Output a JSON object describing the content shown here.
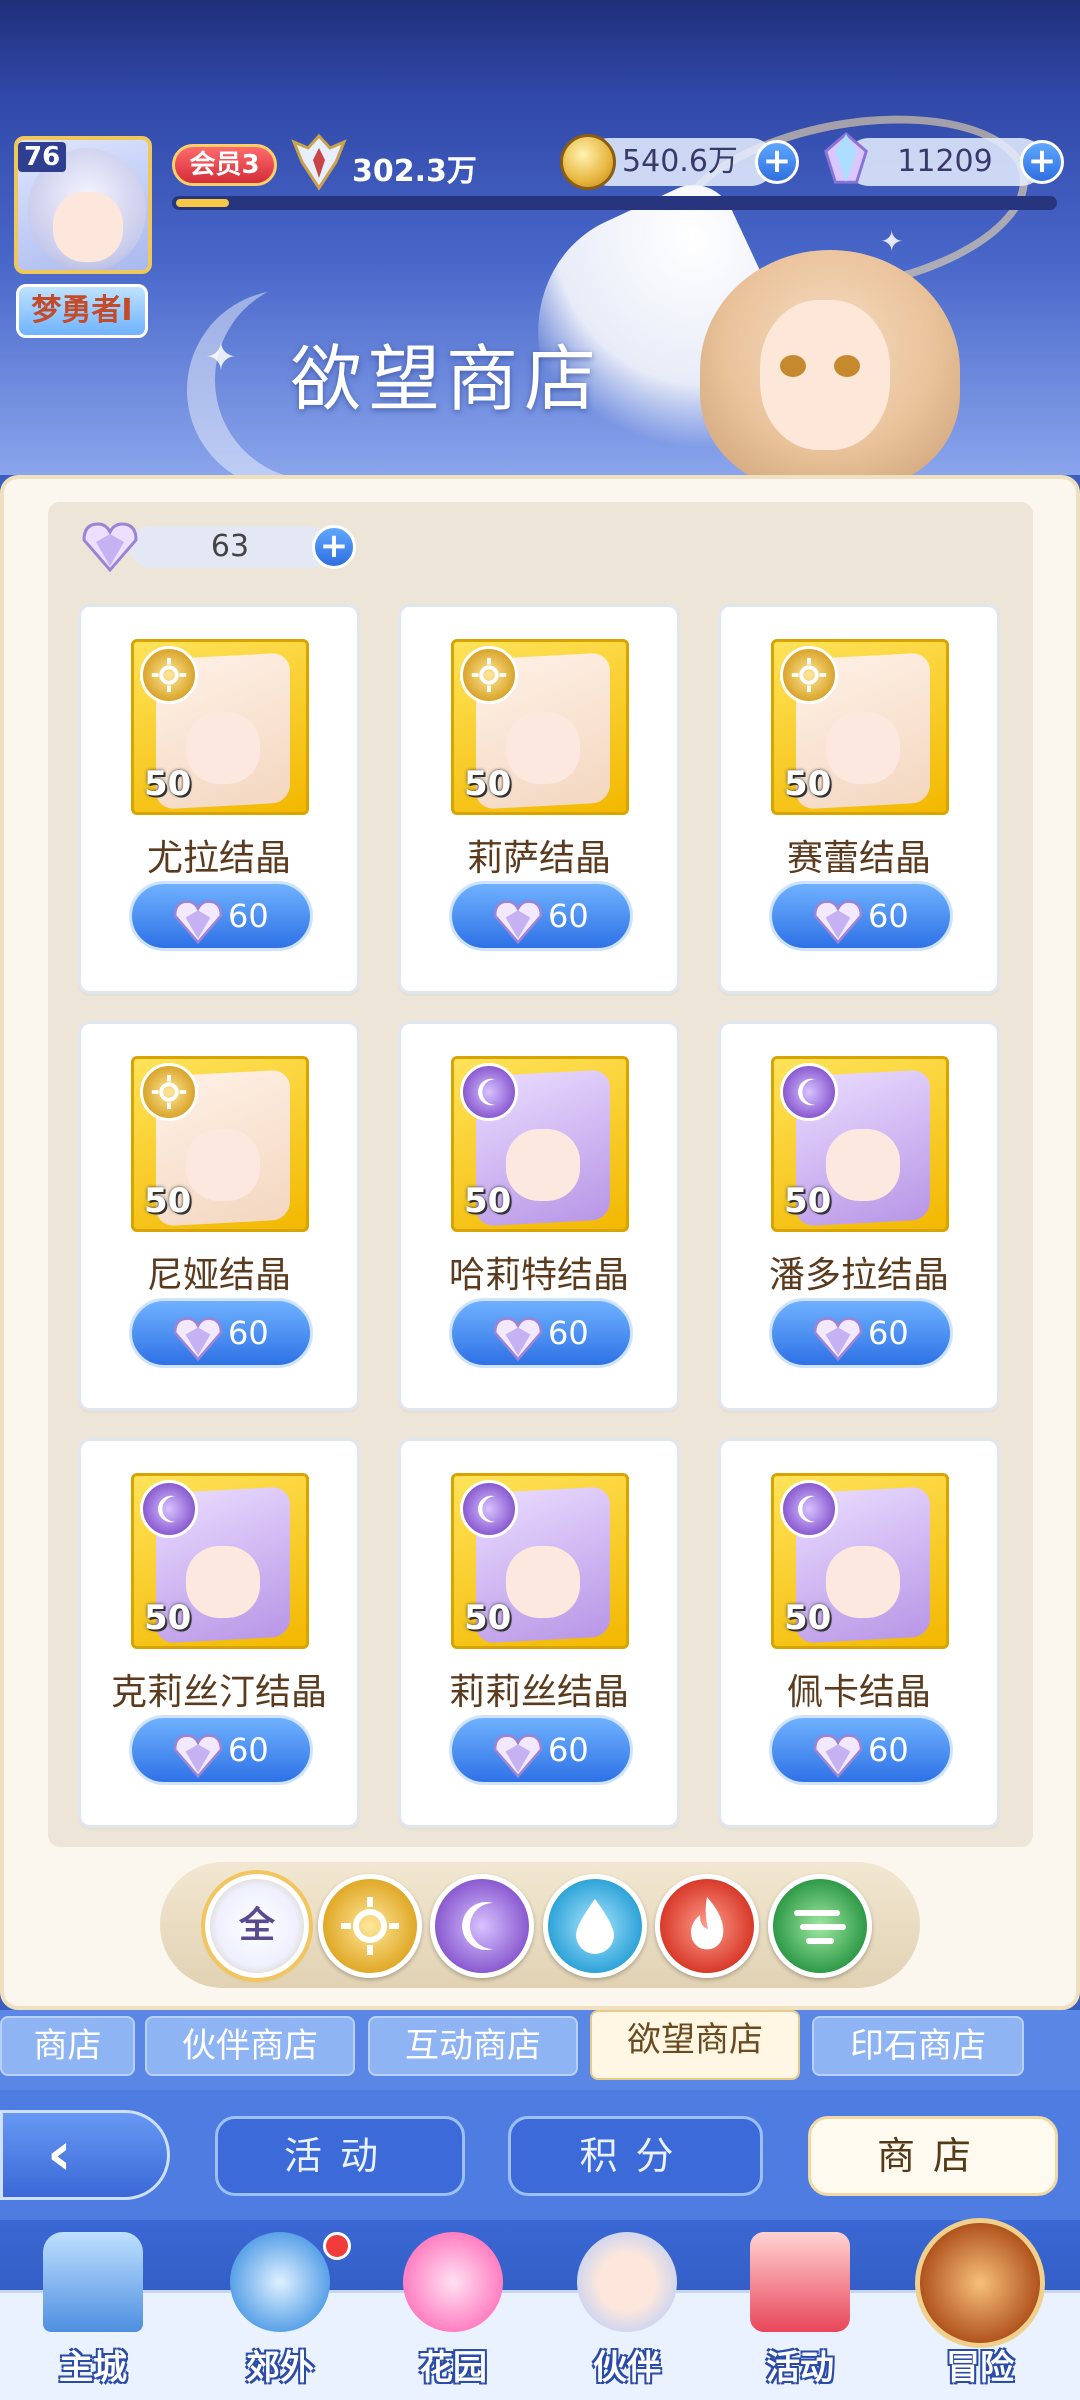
{
  "player": {
    "level": "76",
    "name": "梦勇者I",
    "vip": "会员3",
    "power": "302.3万",
    "exp_fraction": 0.06
  },
  "resources": {
    "gold": "540.6万",
    "crystal": "11209"
  },
  "shop": {
    "title": "欲望商店",
    "currency_amount": "63"
  },
  "items": [
    {
      "name": "尤拉结晶",
      "qty": "50",
      "price": "60",
      "element": "light"
    },
    {
      "name": "莉萨结晶",
      "qty": "50",
      "price": "60",
      "element": "light"
    },
    {
      "name": "赛蕾结晶",
      "qty": "50",
      "price": "60",
      "element": "light"
    },
    {
      "name": "尼娅结晶",
      "qty": "50",
      "price": "60",
      "element": "light"
    },
    {
      "name": "哈莉特结晶",
      "qty": "50",
      "price": "60",
      "element": "dark"
    },
    {
      "name": "潘多拉结晶",
      "qty": "50",
      "price": "60",
      "element": "dark"
    },
    {
      "name": "克莉丝汀结晶",
      "qty": "50",
      "price": "60",
      "element": "dark"
    },
    {
      "name": "莉莉丝结晶",
      "qty": "50",
      "price": "60",
      "element": "dark"
    },
    {
      "name": "佩卡结晶",
      "qty": "50",
      "price": "60",
      "element": "dark"
    }
  ],
  "filters": {
    "all_label": "全",
    "elements": [
      "light-icon",
      "moon-icon",
      "water-icon",
      "fire-icon",
      "wind-icon"
    ]
  },
  "tabs": [
    "商店",
    "伙伴商店",
    "互动商店",
    "欲望商店",
    "印石商店"
  ],
  "subnav": {
    "activity": "活动",
    "points": "积分",
    "shop": "商店"
  },
  "nav": [
    "主城",
    "郊外",
    "花园",
    "伙伴",
    "活动",
    "冒险"
  ],
  "colors": {
    "accent_blue": "#2f72e6",
    "gold": "#f2b800",
    "light_element": "#d9a52b",
    "dark_element": "#8a5bd0"
  }
}
